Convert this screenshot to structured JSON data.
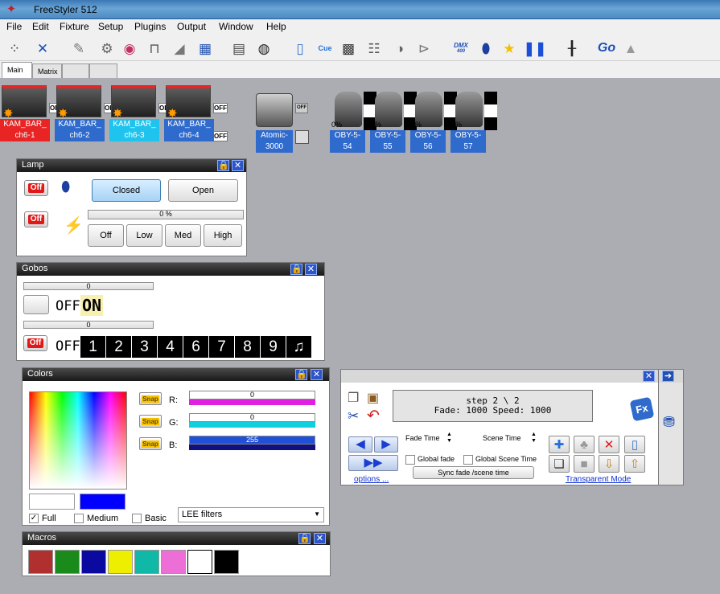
{
  "window": {
    "title": "FreeStyler 512"
  },
  "menu": [
    "File",
    "Edit",
    "Fixture",
    "Setup",
    "Plugins",
    "Output",
    "Window",
    "Help"
  ],
  "toolbar": {
    "dmx_label": "DMX",
    "dmx_sub": "400",
    "go_label": "Go",
    "cue_label": "Cue"
  },
  "tabs": [
    "Main",
    "Matrix",
    "",
    ""
  ],
  "fixtures": {
    "kam_bars": [
      {
        "label1": "KAM_BAR_",
        "label2": "ch6-1",
        "color": "#e82424"
      },
      {
        "label1": "KAM_BAR_",
        "label2": "ch6-2",
        "color": "#2f6acd"
      },
      {
        "label1": "KAM_BAR_",
        "label2": "ch6-3",
        "color": "#1fc4ee"
      },
      {
        "label1": "KAM_BAR_",
        "label2": "ch6-4",
        "color": "#2f6acd"
      }
    ],
    "off_label": "OFF",
    "atomic": {
      "label1": "Atomic-",
      "label2": "3000",
      "tag": "OFF"
    },
    "moving_heads": [
      {
        "label1": "OBY-5-",
        "label2": "54",
        "pct": "0%"
      },
      {
        "label1": "OBY-5-",
        "label2": "55",
        "pct": "%"
      },
      {
        "label1": "OBY-5-",
        "label2": "56",
        "pct": "%"
      },
      {
        "label1": "OBY-5-",
        "label2": "57",
        "pct": "%"
      }
    ]
  },
  "lamp": {
    "title": "Lamp",
    "off": "Off",
    "closed": "Closed",
    "open": "Open",
    "progress_text": "0 %",
    "progress_value": 0,
    "buttons": [
      "Off",
      "Low",
      "Med",
      "High"
    ]
  },
  "gobos": {
    "title": "Gobos",
    "slider1": "0",
    "slider2": "0",
    "off1": "OFF",
    "on": "ON",
    "off_btn": "Off",
    "off2": "OFF",
    "tiles": [
      "1",
      "2",
      "3",
      "4",
      "6",
      "7",
      "8",
      "9",
      "♫"
    ]
  },
  "colors": {
    "title": "Colors",
    "snap": "Snap",
    "r_label": "R:",
    "g_label": "G:",
    "b_label": "B:",
    "r_value": "0",
    "g_value": "0",
    "b_value": "255",
    "selected_color": "#0000ff",
    "options": [
      "Full",
      "Medium",
      "Basic"
    ],
    "full_checked": true,
    "filter_select": "LEE filters"
  },
  "macros": {
    "title": "Macros",
    "swatches": [
      "#b03030",
      "#1a8a1a",
      "#0a0aa0",
      "#eeee00",
      "#10b8a8",
      "#ee6ed8",
      "#ffffff",
      "#000000"
    ]
  },
  "cue": {
    "display_line1": "step 2 \\ 2",
    "display_line2": "Fade: 1000  Speed: 1000",
    "fade_time": "Fade Time",
    "scene_time": "Scene Time",
    "global_fade": "Global fade",
    "global_scene_time": "Global Scene Time",
    "sync": "Sync fade /scene time",
    "options": "options ...",
    "transparent_mode": "Transparent Mode",
    "fx": "Fx"
  }
}
